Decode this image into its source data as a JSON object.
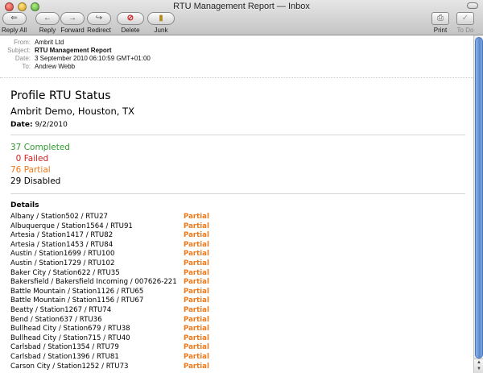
{
  "window": {
    "title": "RTU Management Report — Inbox"
  },
  "toolbar": {
    "reply_all": "Reply All",
    "reply": "Reply",
    "forward": "Forward",
    "redirect": "Redirect",
    "delete": "Delete",
    "junk": "Junk",
    "print": "Print",
    "to_do": "To Do"
  },
  "headers": {
    "from_label": "From:",
    "from": "Ambrit Ltd",
    "subject_label": "Subject:",
    "subject": "RTU Management Report",
    "date_label": "Date:",
    "date": "3 September 2010 06:10:59 GMT+01:00",
    "to_label": "To:",
    "to": "Andrew Webb"
  },
  "report": {
    "title": "Profile RTU Status",
    "subtitle": "Ambrit Demo, Houston, TX",
    "date_label": "Date:",
    "date": "9/2/2010",
    "completed": "37 Completed",
    "failed": "  0 Failed",
    "partial": "76 Partial",
    "disabled": "29 Disabled",
    "details_heading": "Details",
    "colors": {
      "completed": "#2e9a2e",
      "failed": "#d22020",
      "partial": "#f07818",
      "disabled": "#000000"
    },
    "details": [
      {
        "name": "Albany / Station502 / RTU27",
        "status": "Partial"
      },
      {
        "name": "Albuquerque / Station1564 / RTU91",
        "status": "Partial"
      },
      {
        "name": "Artesia / Station1417 / RTU82",
        "status": "Partial"
      },
      {
        "name": "Artesia / Station1453 / RTU84",
        "status": "Partial"
      },
      {
        "name": "Austin / Station1699 / RTU100",
        "status": "Partial"
      },
      {
        "name": "Austin / Station1729 / RTU102",
        "status": "Partial"
      },
      {
        "name": "Baker City / Station622 / RTU35",
        "status": "Partial"
      },
      {
        "name": "Bakersfield / Bakersfield Incoming / 007626-221",
        "status": "Partial"
      },
      {
        "name": "Battle Mountain / Station1126 / RTU65",
        "status": "Partial"
      },
      {
        "name": "Battle Mountain / Station1156 / RTU67",
        "status": "Partial"
      },
      {
        "name": "Beatty / Station1267 / RTU74",
        "status": "Partial"
      },
      {
        "name": "Bend / Station637 / RTU36",
        "status": "Partial"
      },
      {
        "name": "Bullhead City / Station679 / RTU38",
        "status": "Partial"
      },
      {
        "name": "Bullhead City / Station715 / RTU40",
        "status": "Partial"
      },
      {
        "name": "Carlsbad / Station1354 / RTU79",
        "status": "Partial"
      },
      {
        "name": "Carlsbad / Station1396 / RTU81",
        "status": "Partial"
      },
      {
        "name": "Carson City / Station1252 / RTU73",
        "status": "Partial"
      }
    ]
  }
}
